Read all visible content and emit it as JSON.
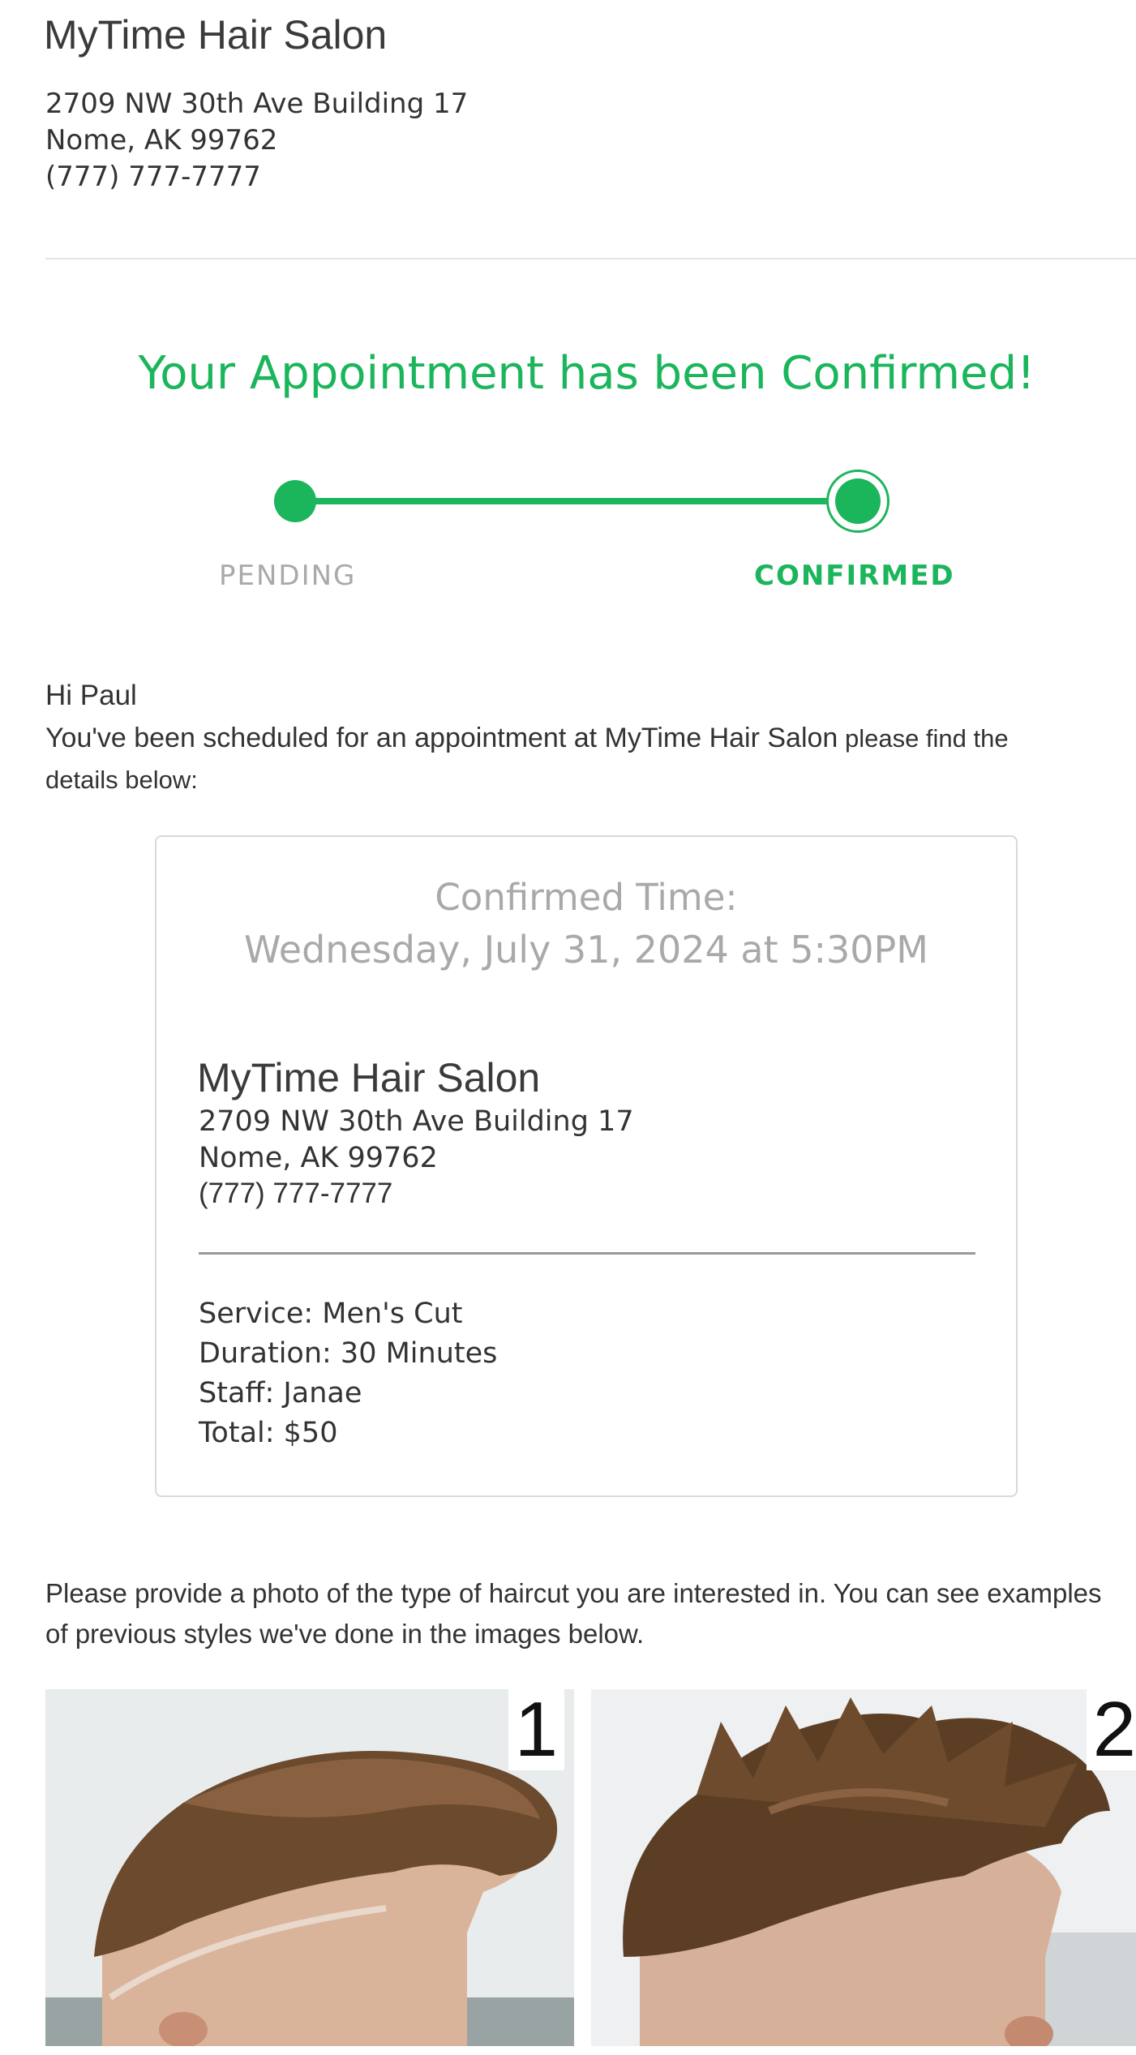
{
  "header": {
    "salon_name": "MyTime Hair Salon",
    "address_line1": "2709 NW 30th Ave Building 17",
    "address_line2": "Nome, AK 99762",
    "phone": "(777) 777-7777"
  },
  "status": {
    "title": "Your Appointment has been Confirmed!",
    "steps": [
      {
        "label": "PENDING",
        "state": "complete"
      },
      {
        "label": "CONFIRMED",
        "state": "current"
      }
    ],
    "accent_color": "#1bb55c"
  },
  "message": {
    "greeting": "Hi Paul",
    "intro_part1": "You've been scheduled for an appointment at MyTime Hair Salon",
    "intro_part2": " please find the details below:"
  },
  "card": {
    "confirmed_label": "Confirmed Time:",
    "confirmed_value": "Wednesday, July 31, 2024 at 5:30PM",
    "salon_name": "MyTime Hair Salon",
    "address_line1": "2709 NW 30th Ave Building 17",
    "address_line2": "Nome, AK 99762",
    "phone": "(777) 777-7777",
    "service": "Service: Men's Cut",
    "duration": "Duration: 30 Minutes",
    "staff": "Staff: Janae",
    "total": "Total: $50"
  },
  "photos": {
    "request_text": "Please provide a photo of the type of haircut you are interested in. You can see examples of previous styles we've done in the images below.",
    "items": [
      {
        "number": "1",
        "icon": "haircut-photo"
      },
      {
        "number": "2",
        "icon": "haircut-photo"
      }
    ]
  }
}
